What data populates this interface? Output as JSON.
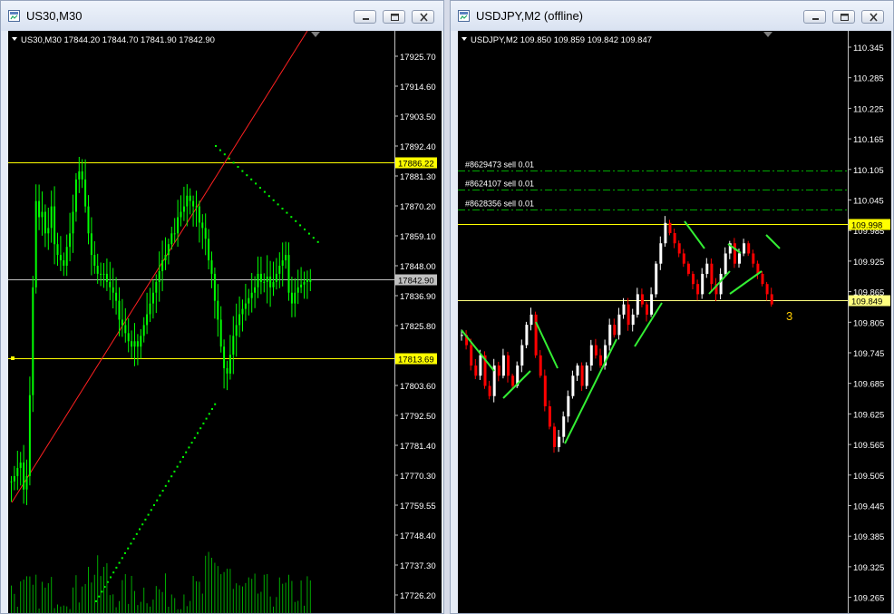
{
  "windows": [
    {
      "title": "US30,M30",
      "chart_data": {
        "type": "candlestick",
        "symbol_info": "US30,M30  17844.20 17844.70 17841.90 17842.90",
        "price_axis": [
          "17925.70",
          "17914.60",
          "17903.50",
          "17892.40",
          "17881.30",
          "17870.20",
          "17859.10",
          "17848.00",
          "17836.90",
          "17825.80",
          "17813.69",
          "17803.60",
          "17792.50",
          "17781.40",
          "17770.30",
          "17759.55",
          "17748.40",
          "17737.30",
          "17726.20"
        ],
        "hlines": [
          {
            "price": "17886.22",
            "color": "#ffff00"
          },
          {
            "price": "17842.90",
            "color": "#c0c0c0"
          },
          {
            "price": "17813.69",
            "color": "#ffff00"
          }
        ],
        "bull_color": "#00ff00",
        "bear_color": "#00ff00"
      }
    },
    {
      "title": "USDJPY,M2 (offline)",
      "chart_data": {
        "type": "candlestick",
        "symbol_info": "USDJPY,M2  109.850 109.859 109.842 109.847",
        "price_axis": [
          "110.345",
          "110.285",
          "110.225",
          "110.165",
          "110.105",
          "110.045",
          "109.985",
          "109.925",
          "109.865",
          "109.805",
          "109.745",
          "109.685",
          "109.625",
          "109.565",
          "109.505",
          "109.445",
          "109.385",
          "109.325",
          "109.265"
        ],
        "orders": [
          "#8629473 sell 0.01",
          "#8624107 sell 0.01",
          "#8628356 sell 0.01"
        ],
        "hlines": [
          {
            "price": "109.998",
            "color": "#ffff00"
          },
          {
            "price": "109.849",
            "color": "#ffff80"
          }
        ],
        "count_label": "3",
        "bull_color": "#ffffff",
        "bear_color": "#ff0000"
      }
    }
  ]
}
